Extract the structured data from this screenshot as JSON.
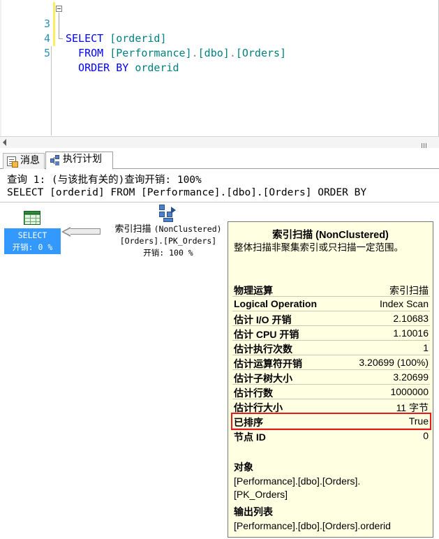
{
  "editor": {
    "lines": [
      {
        "num": "3",
        "segments": [
          {
            "cls": "kw",
            "text": "SELECT "
          },
          {
            "cls": "id",
            "text": "[orderid]"
          }
        ]
      },
      {
        "num": "4",
        "segments": [
          {
            "cls": "kw",
            "text": "  FROM "
          },
          {
            "cls": "id",
            "text": "[Performance]"
          },
          {
            "cls": "gr",
            "text": "."
          },
          {
            "cls": "id",
            "text": "[dbo]"
          },
          {
            "cls": "gr",
            "text": "."
          },
          {
            "cls": "id",
            "text": "[Orders]"
          }
        ]
      },
      {
        "num": "5",
        "segments": [
          {
            "cls": "kw",
            "text": "  ORDER BY "
          },
          {
            "cls": "id",
            "text": "orderid"
          }
        ]
      }
    ]
  },
  "tabs": {
    "messages": "消息",
    "plan": "执行计划"
  },
  "plan": {
    "header_line1": "查询 1: (与该批有关的)查询开销: 100%",
    "header_line2": "SELECT [orderid] FROM [Performance].[dbo].[Orders] ORDER BY",
    "select_node": {
      "name": "SELECT",
      "cost": "开销: 0 %"
    },
    "scan_node": {
      "name": "索引扫描",
      "type": "(NonClustered)",
      "object": "[Orders].[PK_Orders]",
      "cost": "开销: 100 %"
    }
  },
  "tooltip": {
    "title": "索引扫描 (NonClustered)",
    "description": "整体扫描非聚集索引或只扫描一定范围。",
    "properties": [
      {
        "key": "物理运算",
        "value": "索引扫描"
      },
      {
        "key": "Logical Operation",
        "value": "Index Scan"
      },
      {
        "key": "估计 I/O 开销",
        "value": "2.10683"
      },
      {
        "key": "估计 CPU 开销",
        "value": "1.10016"
      },
      {
        "key": "估计执行次数",
        "value": "1"
      },
      {
        "key": "估计运算符开销",
        "value": "3.20699 (100%)"
      },
      {
        "key": "估计子树大小",
        "value": "3.20699"
      },
      {
        "key": "估计行数",
        "value": "1000000"
      },
      {
        "key": "估计行大小",
        "value": "11 字节"
      },
      {
        "key": "已排序",
        "value": "True"
      },
      {
        "key": "节点 ID",
        "value": "0"
      }
    ],
    "object_label": "对象",
    "object_line1": "[Performance].[dbo].[Orders].",
    "object_line2": "[PK_Orders]",
    "output_label": "输出列表",
    "output_value": "[Performance].[dbo].[Orders].orderid"
  },
  "colors": {
    "highlight": "#e8191a",
    "tooltip_bg": "#ffffe1",
    "selected_node": "#3399ff"
  }
}
